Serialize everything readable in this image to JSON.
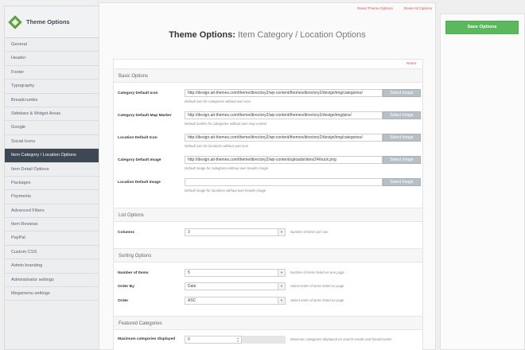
{
  "sidebar": {
    "title": "Theme Options",
    "logo_icon": "diamond-logo-icon",
    "items": [
      "General",
      "Header",
      "Footer",
      "Typography",
      "Breadcrumbs",
      "Sidebars & Widget Areas",
      "Google",
      "Social Icons",
      "Item Category / Location Options",
      "Item Detail Options",
      "Packages",
      "Payments",
      "Advanced Filters",
      "Item Reviews",
      "PayPal",
      "Custom CSS",
      "Admin branding",
      "Administrator settings",
      "Megamenu settings"
    ],
    "active_index": 8
  },
  "top_links": {
    "reset_theme": "Reset Theme Options",
    "reset_all": "Reset All Options"
  },
  "page": {
    "title_prefix": "Theme Options:",
    "title_sub": "Item Category / Location Options",
    "reset": "Reset"
  },
  "basic": {
    "heading": "Basic Options",
    "select_image_label": "Select Image",
    "fields": [
      {
        "label": "Category Default Icon",
        "value": "http://design.ait-themes.com/theme/directory2/wp-content/themes/directory2/design/img/categories/",
        "desc": "Default icon for categories without own icon"
      },
      {
        "label": "Category Default Map Marker",
        "value": "http://design.ait-themes.com/theme/directory2/wp-content/themes/directory2/design/img/pins/",
        "desc": "Default marker for categories without own map marker"
      },
      {
        "label": "Location Default Icon",
        "value": "http://design.ait-themes.com/theme/directory2/wp-content/themes/directory2/design/img/categories/",
        "desc": "Default icon for locations without own icon"
      },
      {
        "label": "Category Default Image",
        "value": "http://design.ait-themes.com/theme/directory2/wp-content/uploads/sites/24/truck.png",
        "desc": "Default image for categories without own header image"
      },
      {
        "label": "Location Default Image",
        "value": "",
        "desc": "Default image for locations without own header image"
      }
    ]
  },
  "list": {
    "heading": "List Options",
    "columns_label": "Columns",
    "columns_value": "3",
    "columns_desc": "Number of items per row"
  },
  "sorting": {
    "heading": "Sorting Options",
    "items_label": "Number of Items",
    "items_value": "5",
    "items_desc": "Number of items listed on one page",
    "orderby_label": "Order By",
    "orderby_value": "Date",
    "orderby_desc": "Select order of items listed on page",
    "order_label": "Order",
    "order_value": "ASC",
    "order_desc": "Select order of items listed on page"
  },
  "featured": {
    "heading": "Featured Categories",
    "max_label": "Maximum categories displayed",
    "max_value": "0",
    "max_desc": "Maximum categories displayed on search results and breadcrumbs"
  },
  "right": {
    "save_label": "Save Options"
  },
  "colors": {
    "accent_green": "#5cb85c",
    "link_red": "#d9534f",
    "active_nav": "#3d4852"
  }
}
